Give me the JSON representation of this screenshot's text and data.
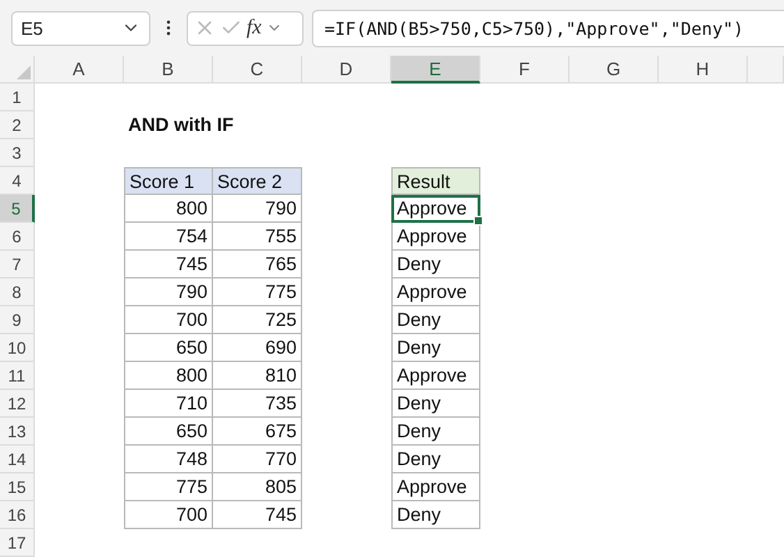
{
  "name_box": "E5",
  "function_button": "fx",
  "formula": "=IF(AND(B5>750,C5>750),\"Approve\",\"Deny\")",
  "columns": [
    {
      "label": "A",
      "selected": false
    },
    {
      "label": "B",
      "selected": false
    },
    {
      "label": "C",
      "selected": false
    },
    {
      "label": "D",
      "selected": false
    },
    {
      "label": "E",
      "selected": true
    },
    {
      "label": "F",
      "selected": false
    },
    {
      "label": "G",
      "selected": false
    },
    {
      "label": "H",
      "selected": false
    }
  ],
  "rows": [
    {
      "label": "1",
      "selected": false
    },
    {
      "label": "2",
      "selected": false
    },
    {
      "label": "3",
      "selected": false
    },
    {
      "label": "4",
      "selected": false
    },
    {
      "label": "5",
      "selected": true
    },
    {
      "label": "6",
      "selected": false
    },
    {
      "label": "7",
      "selected": false
    },
    {
      "label": "8",
      "selected": false
    },
    {
      "label": "9",
      "selected": false
    },
    {
      "label": "10",
      "selected": false
    },
    {
      "label": "11",
      "selected": false
    },
    {
      "label": "12",
      "selected": false
    },
    {
      "label": "13",
      "selected": false
    },
    {
      "label": "14",
      "selected": false
    },
    {
      "label": "15",
      "selected": false
    },
    {
      "label": "16",
      "selected": false
    },
    {
      "label": "17",
      "selected": false
    }
  ],
  "title": "AND with IF",
  "scores": {
    "columns": [
      "Score 1",
      "Score 2"
    ],
    "rows": [
      [
        "800",
        "790"
      ],
      [
        "754",
        "755"
      ],
      [
        "745",
        "765"
      ],
      [
        "790",
        "775"
      ],
      [
        "700",
        "725"
      ],
      [
        "650",
        "690"
      ],
      [
        "800",
        "810"
      ],
      [
        "710",
        "735"
      ],
      [
        "650",
        "675"
      ],
      [
        "748",
        "770"
      ],
      [
        "775",
        "805"
      ],
      [
        "700",
        "745"
      ]
    ]
  },
  "results": {
    "column": "Result",
    "rows": [
      {
        "text": "Approve",
        "selected": true
      },
      {
        "text": "Approve",
        "selected": false
      },
      {
        "text": "Deny",
        "selected": false
      },
      {
        "text": "Approve",
        "selected": false
      },
      {
        "text": "Deny",
        "selected": false
      },
      {
        "text": "Deny",
        "selected": false
      },
      {
        "text": "Approve",
        "selected": false
      },
      {
        "text": "Deny",
        "selected": false
      },
      {
        "text": "Deny",
        "selected": false
      },
      {
        "text": "Deny",
        "selected": false
      },
      {
        "text": "Approve",
        "selected": false
      },
      {
        "text": "Deny",
        "selected": false
      }
    ]
  }
}
